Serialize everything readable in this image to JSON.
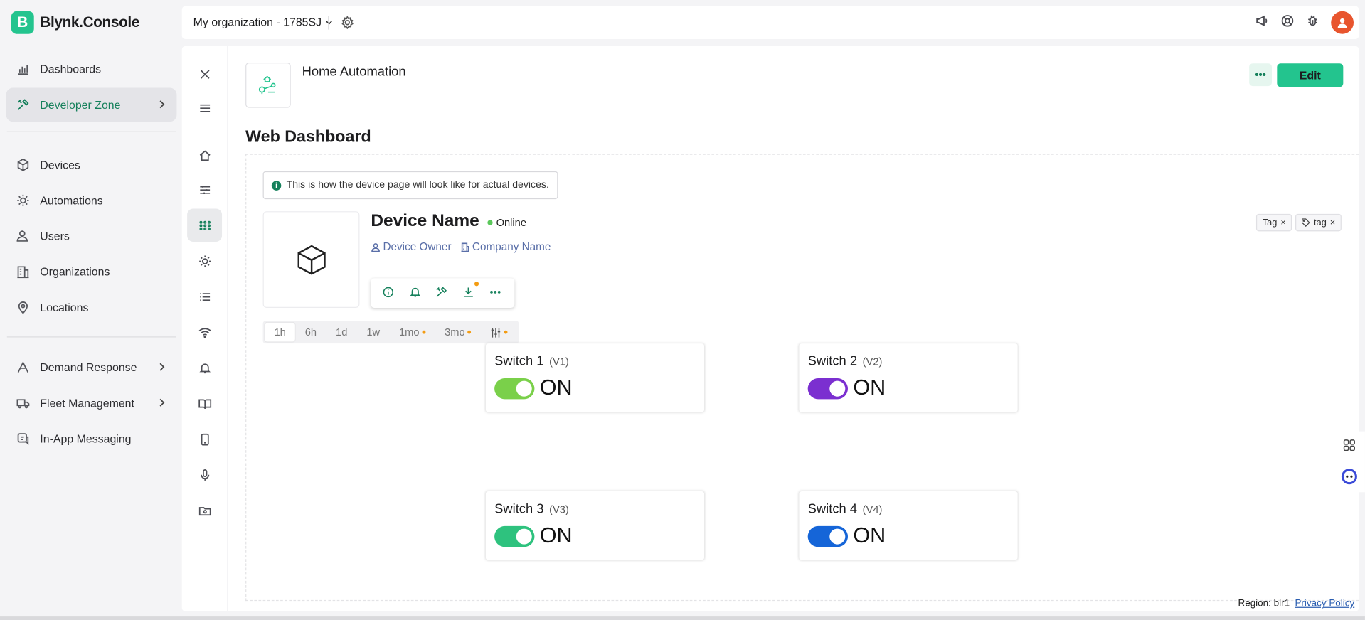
{
  "app": {
    "logo_letter": "B",
    "name": "Blynk.Console",
    "brand_color": "#23c48e"
  },
  "sidebar": {
    "items": [
      {
        "label": "Dashboards",
        "icon": "bar-chart-icon"
      },
      {
        "label": "Developer Zone",
        "icon": "tools-icon",
        "active": true
      },
      {
        "label": "Devices",
        "icon": "cube-icon"
      },
      {
        "label": "Automations",
        "icon": "sun-icon"
      },
      {
        "label": "Users",
        "icon": "users-icon"
      },
      {
        "label": "Organizations",
        "icon": "building-icon"
      },
      {
        "label": "Locations",
        "icon": "location-pin-icon"
      },
      {
        "label": "Demand Response",
        "icon": "compass-icon"
      },
      {
        "label": "Fleet Management",
        "icon": "truck-icon"
      },
      {
        "label": "In-App Messaging",
        "icon": "message-icon"
      }
    ]
  },
  "topbar": {
    "organization": "My organization - 1785SJ"
  },
  "template": {
    "name": "Home Automation"
  },
  "header": {
    "more_label": "•••",
    "edit_label": "Edit"
  },
  "section_title": "Web Dashboard",
  "info_note": "This is how the device page will look like for actual devices.",
  "device": {
    "name": "Device Name",
    "status": "Online",
    "owner": "Device Owner",
    "company": "Company Name",
    "tags": [
      "Tag",
      "tag"
    ]
  },
  "time_ranges": [
    "1h",
    "6h",
    "1d",
    "1w",
    "1mo",
    "3mo"
  ],
  "widgets": [
    {
      "title": "Switch 1",
      "pin": "(V1)",
      "state": "ON",
      "color": "#7ad04a"
    },
    {
      "title": "Switch 2",
      "pin": "(V2)",
      "state": "ON",
      "color": "#7b2fd0"
    },
    {
      "title": "Switch 3",
      "pin": "(V3)",
      "state": "ON",
      "color": "#2ec27e"
    },
    {
      "title": "Switch 4",
      "pin": "(V4)",
      "state": "ON",
      "color": "#1565d8"
    }
  ],
  "footer": {
    "region": "Region: blr1",
    "privacy": "Privacy Policy"
  }
}
